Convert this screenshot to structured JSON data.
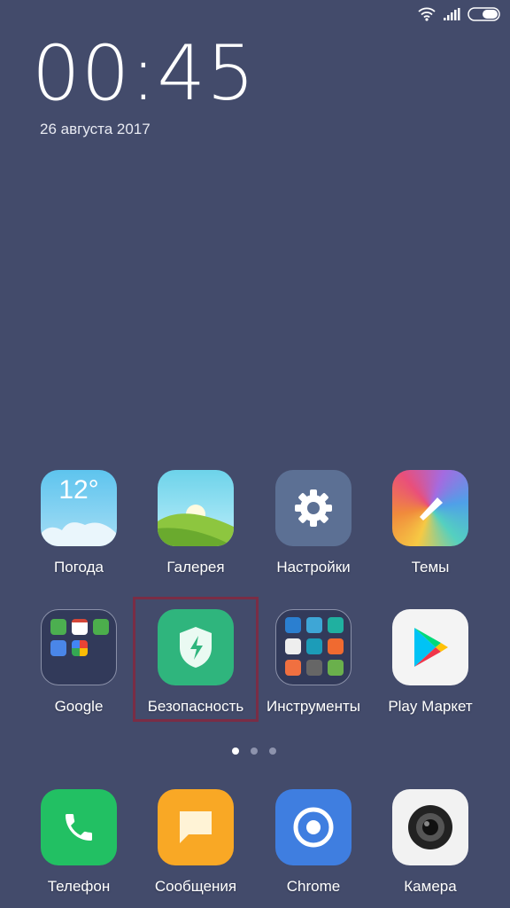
{
  "status_bar": {
    "icons": [
      "wifi-icon",
      "signal-icon",
      "battery-icon"
    ]
  },
  "lockclock": {
    "time": "00:45",
    "date": "26 августа 2017"
  },
  "apps": [
    {
      "label": "Погода",
      "icon": "weather-icon",
      "temp": "12°"
    },
    {
      "label": "Галерея",
      "icon": "gallery-icon"
    },
    {
      "label": "Настройки",
      "icon": "settings-icon"
    },
    {
      "label": "Темы",
      "icon": "themes-icon"
    },
    {
      "label": "Google",
      "icon": "folder-icon"
    },
    {
      "label": "Безопасность",
      "icon": "security-shield-icon"
    },
    {
      "label": "Инструменты",
      "icon": "folder-icon"
    },
    {
      "label": "Play Маркет",
      "icon": "play-store-icon"
    }
  ],
  "pages": {
    "count": 3,
    "current": 1
  },
  "dock": [
    {
      "label": "Телефон",
      "icon": "phone-icon"
    },
    {
      "label": "Сообщения",
      "icon": "messages-icon"
    },
    {
      "label": "Chrome",
      "icon": "chrome-icon"
    },
    {
      "label": "Камера",
      "icon": "camera-icon"
    }
  ],
  "colors": {
    "background": "#434b6b",
    "highlight": "#7a2d45",
    "security": "#2fb57d"
  }
}
